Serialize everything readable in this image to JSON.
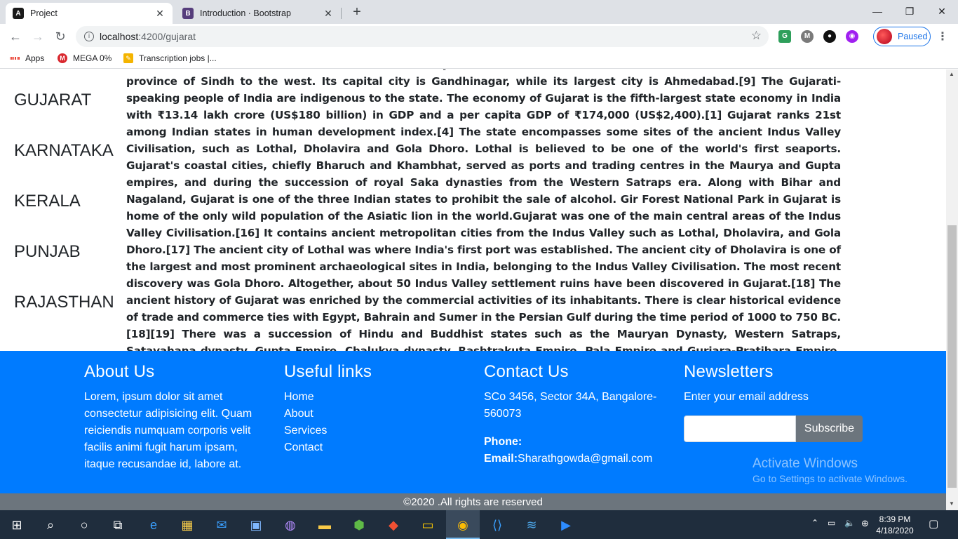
{
  "browser": {
    "tabs": [
      {
        "title": "Project",
        "favicon": "angular-icon",
        "active": true
      },
      {
        "title": "Introduction · Bootstrap",
        "favicon": "bootstrap-icon",
        "active": false
      }
    ],
    "address_host": "localhost",
    "address_path": ":4200/gujarat",
    "profile_status": "Paused",
    "bookmarks": [
      "Apps",
      "MEGA 0%",
      "Transcription jobs |..."
    ]
  },
  "sidebar": {
    "states": [
      "GUJARAT",
      "KARNATAKA",
      "KERALA",
      "PUNJAB",
      "RAJASTHAN"
    ]
  },
  "article": {
    "text": "to the south, Maharashtra to the southeast, Madhya Pradesh to the east, and the Arabian Sea and the Pakistani province of Sindh to the west. Its capital city is Gandhinagar, while its largest city is Ahmedabad.[9] The Gujarati-speaking people of India are indigenous to the state. The economy of Gujarat is the fifth-largest state economy in India with ₹13.14 lakh crore (US$180 billion) in GDP and a per capita GDP of ₹174,000 (US$2,400).[1] Gujarat ranks 21st among Indian states in human development index.[4] The state encompasses some sites of the ancient Indus Valley Civilisation, such as Lothal, Dholavira and Gola Dhoro. Lothal is believed to be one of the world's first seaports. Gujarat's coastal cities, chiefly Bharuch and Khambhat, served as ports and trading centres in the Maurya and Gupta empires, and during the succession of royal Saka dynasties from the Western Satraps era. Along with Bihar and Nagaland, Gujarat is one of the three Indian states to prohibit the sale of alcohol. Gir Forest National Park in Gujarat is home of the only wild population of the Asiatic lion in the world.Gujarat was one of the main central areas of the Indus Valley Civilisation.[16] It contains ancient metropolitan cities from the Indus Valley such as Lothal, Dholavira, and Gola Dhoro.[17] The ancient city of Lothal was where India's first port was established. The ancient city of Dholavira is one of the largest and most prominent archaeological sites in India, belonging to the Indus Valley Civilisation. The most recent discovery was Gola Dhoro. Altogether, about 50 Indus Valley settlement ruins have been discovered in Gujarat.[18] The ancient history of Gujarat was enriched by the commercial activities of its inhabitants. There is clear historical evidence of trade and commerce ties with Egypt, Bahrain and Sumer in the Persian Gulf during the time period of 1000 to 750 BC.[18][19] There was a succession of Hindu and Buddhist states such as the Mauryan Dynasty, Western Satraps, Satavahana dynasty, Gupta Empire, Chalukya dynasty, Rashtrakuta Empire, Pala Empire and Gurjara-Pratihara Empire, as well as local dynasties such as the Maitrakas and then the Chaulukyas."
  },
  "footer": {
    "about": {
      "heading": "About Us",
      "text": "Lorem, ipsum dolor sit amet consectetur adipisicing elit. Quam reiciendis numquam corporis velit facilis animi fugit harum ipsam, itaque recusandae id, labore at."
    },
    "links": {
      "heading": "Useful links",
      "items": [
        "Home",
        "About",
        "Services",
        "Contact"
      ]
    },
    "contact": {
      "heading": "Contact Us",
      "address": "SCo 3456, Sector 34A, Bangalore-560073",
      "phone_label": "Phone:",
      "email_label": "Email:",
      "email": "Sharathgowda@gmail.com"
    },
    "newsletter": {
      "heading": "Newsletters",
      "prompt": "Enter your email address",
      "input_value": "",
      "button": "Subscribe"
    },
    "watermark": {
      "line1": "Activate Windows",
      "line2": "Go to Settings to activate Windows."
    },
    "copyright": "©2020 .All rights are reserved"
  },
  "taskbar": {
    "time": "8:39 PM",
    "date": "4/18/2020"
  },
  "colors": {
    "footer_bg": "#007bff",
    "copyright_bg": "#6c757d",
    "taskbar_bg": "#1f2d3d"
  }
}
